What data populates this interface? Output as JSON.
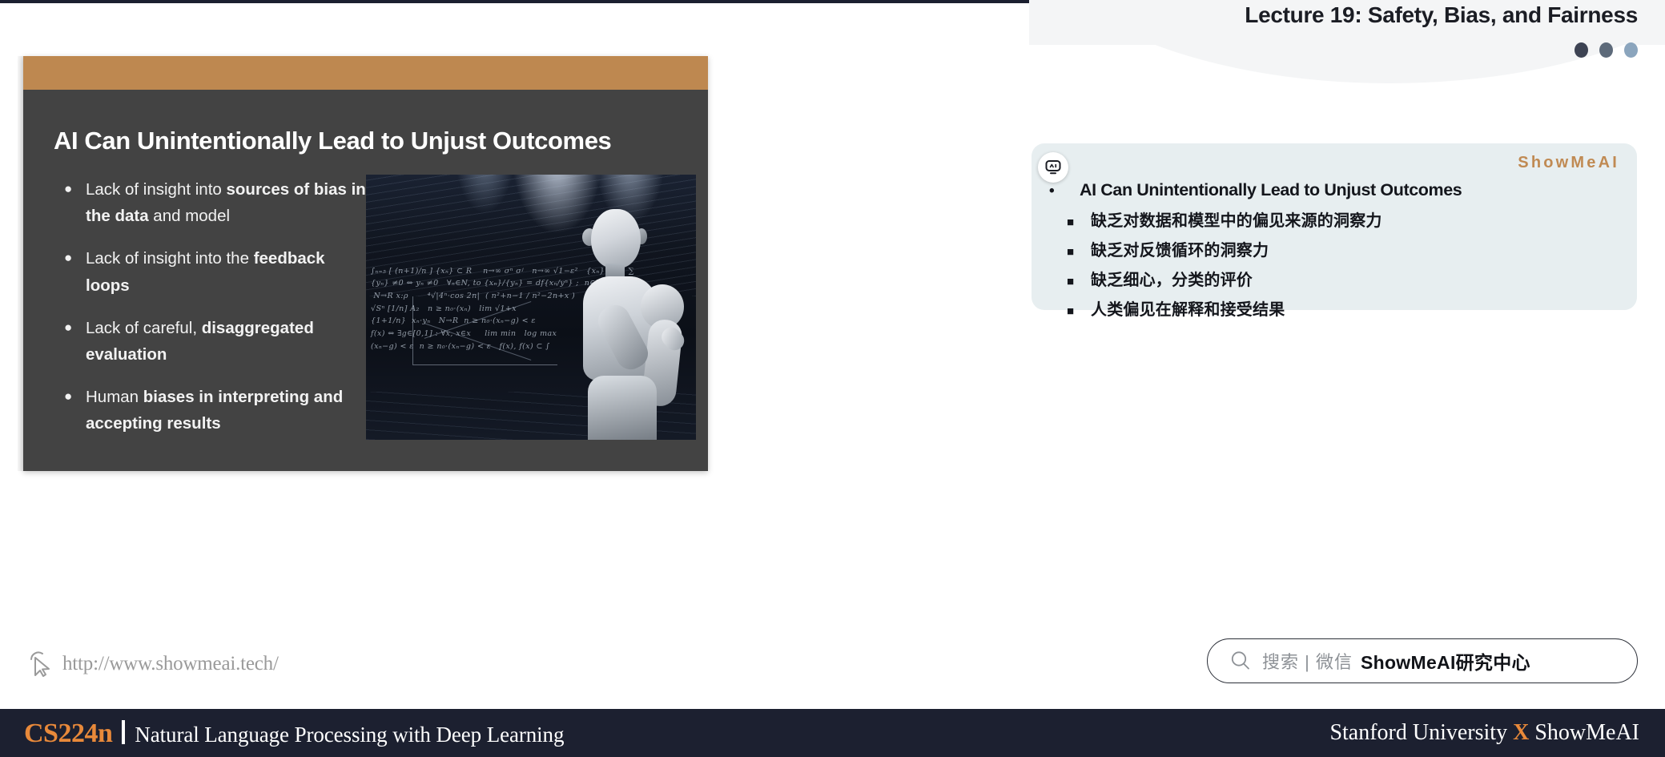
{
  "header": {
    "lecture_title": "Lecture 19: Safety, Bias, and Fairness",
    "dots": [
      "dot-dark",
      "dot-medium",
      "dot-light"
    ]
  },
  "slide": {
    "title": "AI Can Unintentionally Lead to Unjust Outcomes",
    "accent_bar_color": "#be8850",
    "background_color": "#434343",
    "bullets": [
      {
        "marker": "●",
        "parts": [
          {
            "text": "Lack of insight into ",
            "bold": false
          },
          {
            "text": "sources of bias in the data",
            "bold": true
          },
          {
            "text": " and model",
            "bold": false
          }
        ]
      },
      {
        "marker": "●",
        "parts": [
          {
            "text": "Lack of insight into the ",
            "bold": false
          },
          {
            "text": "feedback loops",
            "bold": true
          }
        ]
      },
      {
        "marker": "●",
        "parts": [
          {
            "text": "Lack of careful, ",
            "bold": false
          },
          {
            "text": "disaggregated evaluation",
            "bold": true
          }
        ]
      },
      {
        "marker": "●",
        "parts": [
          {
            "text": "Human ",
            "bold": false
          },
          {
            "text": "biases in interpreting and accepting results",
            "bold": true
          }
        ]
      }
    ],
    "image": {
      "icon_name": "robot-blackboard-image",
      "alt": "Humanoid robot standing in front of a blackboard covered in mathematical equations",
      "blackboard_text": "∫ₙ₌₅ [ (n+1)/n ] {xₙ} ⊂ R    n→∞ σⁿ σʲ   n→∞ √1−ε²   {xₙ} ⊂ R  ∑\n{yₙ} ≠0 ⇔ yₙ ≠0   ∀ₙ∈N, to {xₙ}/{yₙ} = df{xₙ/yⁿ} ;  n∈N, x·\n N→R x:ρ       ⁴√|4ⁿ·cos 2n|  ( n²+n−1 / n²−2n+x )\n√Sⁿ [1/n] A₂   n ≥ n₀·(xₙ)   lim √1+x\n{1+1/n}  xₙ·yₙ   N→R  n ≥ n₀·(xₙ−g) < ε\nf(x) ⇔ ∃g∈[0,1] : ∀x, x∈x     lim min   log max\n(xₙ−g) < ε  n ≥ n₀·(xₙ−g) < ε   f(x), f(x) ⊂ ∫"
    },
    "url_footer": {
      "icon_name": "cursor-pointer-icon",
      "url": "http://www.showmeai.tech/"
    }
  },
  "notes_panel": {
    "badge_icon_name": "ai-robot-badge-icon",
    "logo": "ShowMeAI",
    "items": [
      {
        "level": 1,
        "marker": "•",
        "text": "AI Can Unintentionally Lead to Unjust Outcomes"
      },
      {
        "level": 2,
        "marker": "■",
        "text": "缺乏对数据和模型中的偏见来源的洞察力"
      },
      {
        "level": 2,
        "marker": "■",
        "text": "缺乏对反馈循环的洞察力"
      },
      {
        "level": 2,
        "marker": "■",
        "text": "缺乏细心，分类的评价"
      },
      {
        "level": 2,
        "marker": "■",
        "text": "人类偏见在解释和接受结果"
      }
    ]
  },
  "search_pill": {
    "icon_name": "search-icon",
    "gray_text": "搜索 | 微信",
    "bold_text": "ShowMeAI研究中心"
  },
  "bottom_bar": {
    "course_code": "CS224n",
    "course_name": "Natural Language Processing with Deep Learning",
    "right_prefix": "Stanford University ",
    "right_x": "X",
    "right_suffix": " ShowMeAI",
    "accent_color": "#e8893a",
    "background_color": "#1c2030"
  }
}
